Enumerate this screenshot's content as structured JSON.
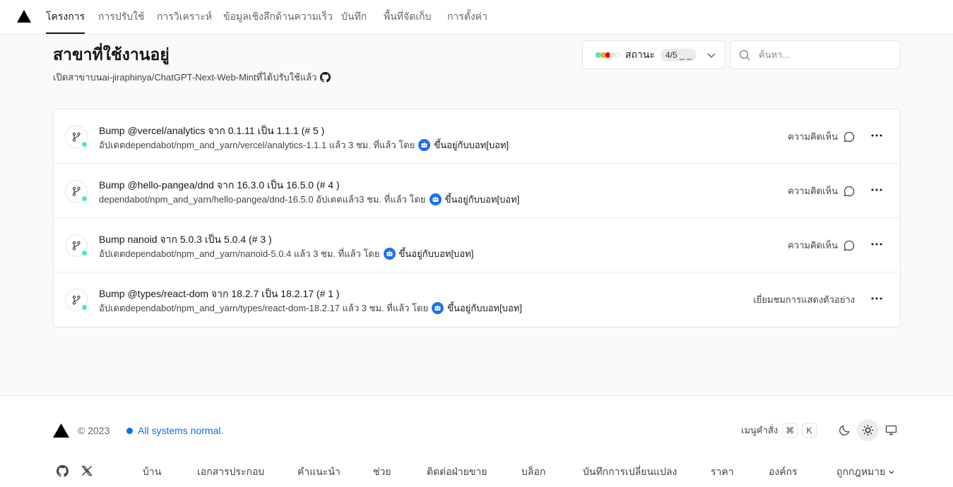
{
  "nav": {
    "tabs": [
      {
        "label": "โครงการ",
        "active": true
      },
      {
        "label": "การปรับใช้",
        "active": false
      },
      {
        "label": "การวิเคราะห์",
        "active": false
      },
      {
        "label": "ข้อมูลเชิงลึกด้านความเร็ว",
        "active": false
      },
      {
        "label": "บันทึก",
        "active": false
      },
      {
        "label": "พื้นที่จัดเก็บ",
        "active": false
      },
      {
        "label": "การตั้งค่า",
        "active": false
      }
    ]
  },
  "header": {
    "title": "สาขาที่ใช้งานอยู่",
    "subtitle": "เปิดสาขาบนai-jiraphinya/ChatGPT-Next-Web-Mintที่ได้ปรับใช้แล้ว"
  },
  "status_filter": {
    "label": "สถานะ",
    "count": "4/5 _ _",
    "dot_colors": [
      "#50e3c2",
      "#f5a623",
      "#ee0000",
      "#e5e5e5",
      "#e5e5e5"
    ]
  },
  "search": {
    "placeholder": "ค้นหา..."
  },
  "branches": [
    {
      "title": "Bump @vercel/analytics จาก 0.1.11 เป็น 1.1.1 (# 5 )",
      "meta": "อัปเดตdependabot/npm_and_yarn/vercel/analytics-1.1.1 แล้ว 3 ชม. ที่แล้ว โดย",
      "bot": "ขึ้นอยู่กับบอท[บอท]",
      "action": "ความคิดเห็น",
      "has_comment_icon": true
    },
    {
      "title": "Bump @hello-pangea/dnd จาก 16.3.0 เป็น 16.5.0 (# 4 )",
      "meta": "dependabot/npm_and_yarn/hello-pangea/dnd-16.5.0 อัปเดตแล้ว3 ชม. ที่แล้ว โดย",
      "bot": "ขึ้นอยู่กับบอท[บอท]",
      "action": "ความคิดเห็น",
      "has_comment_icon": true
    },
    {
      "title": "Bump nanoid จาก 5.0.3 เป็น 5.0.4 (# 3 )",
      "meta": "อัปเดตdependabot/npm_and_yarn/nanoid-5.0.4 แล้ว 3 ชม. ที่แล้ว โดย",
      "bot": "ขึ้นอยู่กับบอท[บอท]",
      "action": "ความคิดเห็น",
      "has_comment_icon": true
    },
    {
      "title": "Bump @types/react-dom จาก 18.2.7 เป็น 18.2.17 (# 1 )",
      "meta": "อัปเดตdependabot/npm_and_yarn/types/react-dom-18.2.17 แล้ว 3 ชม. ที่แล้ว โดย",
      "bot": "ขึ้นอยู่กับบอท[บอท]",
      "action": "เยี่ยมชมการแสดงตัวอย่าง",
      "has_comment_icon": false
    }
  ],
  "footer": {
    "copyright": "© 2023",
    "system_status": "All systems normal.",
    "command_menu": "เมนูคำสั่ง",
    "kbd_cmd": "⌘",
    "kbd_k": "K",
    "links": [
      "บ้าน",
      "เอกสารประกอบ",
      "คำแนะนำ",
      "ช่วย",
      "ติดต่อฝ่ายขาย",
      "บล็อก",
      "บันทึกการเปลี่ยนแปลง",
      "ราคา",
      "องค์กร",
      "ถูกกฎหมาย"
    ]
  },
  "colors": {
    "accent_blue": "#0070f3",
    "branch_status": "#50e3c2",
    "bot_badge": "#1f6feb"
  }
}
